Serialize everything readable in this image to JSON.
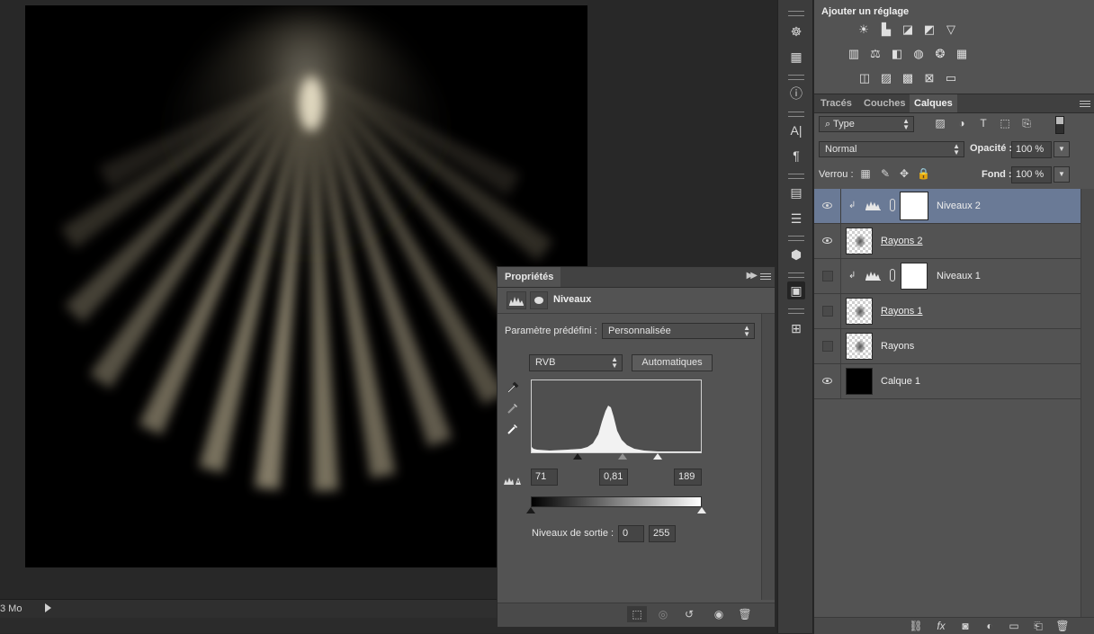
{
  "status": {
    "doc_size": "3 Mo"
  },
  "properties": {
    "tab": "Propriétés",
    "title": "Niveaux",
    "preset_label": "Paramètre prédéfini :",
    "preset_value": "Personnalisée",
    "channel": "RVB",
    "auto_label": "Automatiques",
    "input_black": "71",
    "input_gamma": "0,81",
    "input_white": "189",
    "output_label": "Niveaux de sortie :",
    "output_black": "0",
    "output_white": "255"
  },
  "adjustments": {
    "title": "Ajouter un réglage"
  },
  "layers_panel": {
    "tabs": [
      "Tracés",
      "Couches",
      "Calques"
    ],
    "active_tab": "Calques",
    "filter": "Type",
    "blend_mode": "Normal",
    "opacity_label": "Opacité :",
    "opacity": "100 %",
    "lock_label": "Verrou :",
    "fill_label": "Fond :",
    "fill": "100 %",
    "layers": [
      {
        "name": "Niveaux 2",
        "visible": true,
        "selected": true,
        "kind": "adjustment"
      },
      {
        "name": "Rayons 2",
        "visible": true,
        "selected": false,
        "kind": "pixel"
      },
      {
        "name": "Niveaux 1",
        "visible": false,
        "selected": false,
        "kind": "adjustment"
      },
      {
        "name": "Rayons 1",
        "visible": false,
        "selected": false,
        "kind": "pixel"
      },
      {
        "name": "Rayons",
        "visible": false,
        "selected": false,
        "kind": "pixel"
      },
      {
        "name": "Calque 1",
        "visible": true,
        "selected": false,
        "kind": "fill-black"
      }
    ]
  },
  "colors": {
    "selection": "#6a7a96",
    "panel": "#535353",
    "background": "#282828"
  }
}
